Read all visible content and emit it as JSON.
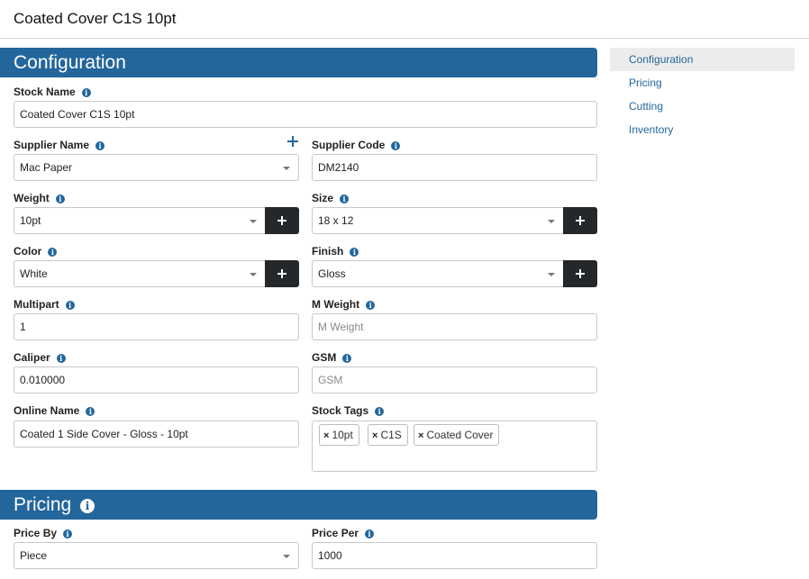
{
  "page": {
    "title": "Coated Cover C1S 10pt"
  },
  "sections": {
    "configuration": "Configuration",
    "pricing": "Pricing",
    "pricing_info": "i"
  },
  "fields": {
    "stock_name": {
      "label": "Stock Name",
      "value": "Coated Cover C1S 10pt"
    },
    "supplier_name": {
      "label": "Supplier Name",
      "value": "Mac Paper"
    },
    "supplier_code": {
      "label": "Supplier Code",
      "value": "DM2140"
    },
    "weight": {
      "label": "Weight",
      "value": "10pt"
    },
    "size": {
      "label": "Size",
      "value": "18 x 12"
    },
    "color": {
      "label": "Color",
      "value": "White"
    },
    "finish": {
      "label": "Finish",
      "value": "Gloss"
    },
    "multipart": {
      "label": "Multipart",
      "value": "1"
    },
    "m_weight": {
      "label": "M Weight",
      "placeholder": "M Weight"
    },
    "caliper": {
      "label": "Caliper",
      "value": "0.010000"
    },
    "gsm": {
      "label": "GSM",
      "placeholder": "GSM"
    },
    "online_name": {
      "label": "Online Name",
      "value": "Coated 1 Side Cover - Gloss - 10pt"
    },
    "stock_tags": {
      "label": "Stock Tags",
      "tags": [
        "10pt",
        "C1S",
        "Coated Cover"
      ]
    },
    "price_by": {
      "label": "Price By",
      "value": "Piece"
    },
    "price_per": {
      "label": "Price Per",
      "value": "1000"
    }
  },
  "info_glyph": "i",
  "tag_remove_glyph": "×",
  "nav": {
    "items": [
      {
        "label": "Configuration",
        "active": true
      },
      {
        "label": "Pricing"
      },
      {
        "label": "Cutting"
      },
      {
        "label": "Inventory"
      }
    ]
  },
  "colors": {
    "accent": "#23669c",
    "dark_button": "#24282b"
  }
}
